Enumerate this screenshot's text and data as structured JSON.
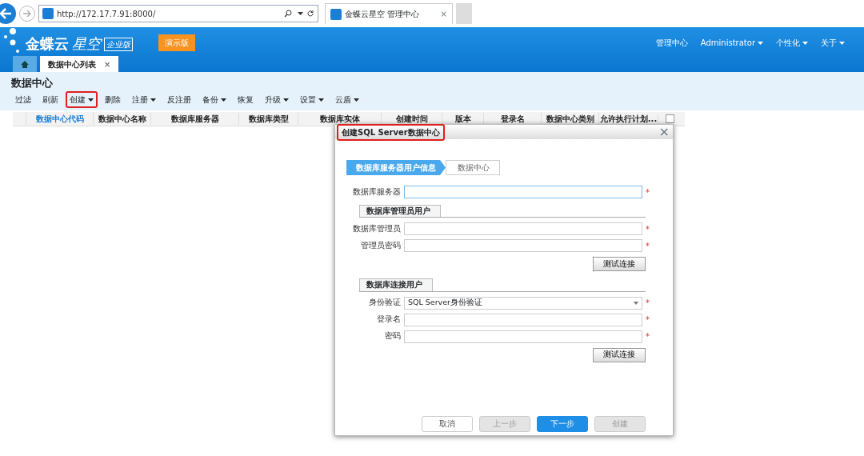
{
  "browser": {
    "url": "http://172.17.7.91:8000/",
    "tab_title": "金蝶云星空 管理中心",
    "tab_close": "×"
  },
  "header": {
    "logo": "金蝶云",
    "logo_sub": "星空",
    "edition": "企业版",
    "demo_badge": "演示版",
    "menu": [
      {
        "label": "管理中心",
        "dropdown": false
      },
      {
        "label": "Administrator",
        "dropdown": true
      },
      {
        "label": "个性化",
        "dropdown": true
      },
      {
        "label": "关于",
        "dropdown": true
      }
    ]
  },
  "tabs": [
    {
      "kind": "home",
      "selected": false
    },
    {
      "kind": "page",
      "label": "数据中心列表",
      "close": "×",
      "selected": true
    }
  ],
  "page_title": "数据中心",
  "toolbar": [
    {
      "label": "过滤",
      "dropdown": false,
      "highlighted": false
    },
    {
      "label": "刷新",
      "dropdown": false,
      "highlighted": false
    },
    {
      "label": "创建",
      "dropdown": true,
      "highlighted": true
    },
    {
      "label": "删除",
      "dropdown": false,
      "highlighted": false
    },
    {
      "label": "注册",
      "dropdown": true,
      "highlighted": false
    },
    {
      "label": "反注册",
      "dropdown": false,
      "highlighted": false
    },
    {
      "label": "备份",
      "dropdown": true,
      "highlighted": false
    },
    {
      "label": "恢复",
      "dropdown": false,
      "highlighted": false
    },
    {
      "label": "升级",
      "dropdown": true,
      "highlighted": false
    },
    {
      "label": "设置",
      "dropdown": true,
      "highlighted": false
    },
    {
      "label": "云盾",
      "dropdown": true,
      "highlighted": false
    }
  ],
  "table": {
    "columns": [
      {
        "label": "数据中心代码",
        "selected": true
      },
      {
        "label": "数据中心名称",
        "selected": false
      },
      {
        "label": "数据库服务器",
        "selected": false
      },
      {
        "label": "数据库类型",
        "selected": false
      },
      {
        "label": "数据库实体",
        "selected": false
      },
      {
        "label": "创建时间",
        "selected": false
      },
      {
        "label": "版本",
        "selected": false
      },
      {
        "label": "登录名",
        "selected": false
      },
      {
        "label": "数据中心类别",
        "selected": false
      },
      {
        "label": "允许执行计划...",
        "selected": false
      }
    ],
    "select_all_checked": false
  },
  "dialog": {
    "title": "创建SQL Server数据中心",
    "title_highlighted": true,
    "close": "×",
    "steps": [
      {
        "label": "数据库服务器用户信息",
        "selected": true
      },
      {
        "label": "数据中心",
        "selected": false
      }
    ],
    "rows": [
      {
        "kind": "field",
        "label": "数据库服务器",
        "required_mark": "*",
        "focused": true
      },
      {
        "kind": "section",
        "label": "数据库管理员用户"
      },
      {
        "kind": "field",
        "label": "数据库管理员",
        "required_mark": "*",
        "focused": false
      },
      {
        "kind": "field",
        "label": "管理员密码",
        "required_mark": "*",
        "focused": false
      },
      {
        "kind": "button",
        "label": "测试连接"
      },
      {
        "kind": "section",
        "label": "数据库连接用户"
      },
      {
        "kind": "select",
        "label": "身份验证",
        "value": "SQL Server身份验证",
        "required_mark": "*",
        "focused": false
      },
      {
        "kind": "field",
        "label": "登录名",
        "required_mark": "*",
        "focused": false
      },
      {
        "kind": "field",
        "label": "密码",
        "required_mark": "*",
        "focused": false
      },
      {
        "kind": "button",
        "label": "测试连接"
      }
    ],
    "buttons": [
      {
        "label": "取消",
        "kind": "normal",
        "disabled": false
      },
      {
        "label": "上一步",
        "kind": "normal",
        "disabled": true
      },
      {
        "label": "下一步",
        "kind": "primary",
        "disabled": false
      },
      {
        "label": "创建",
        "kind": "normal",
        "disabled": true
      }
    ]
  }
}
